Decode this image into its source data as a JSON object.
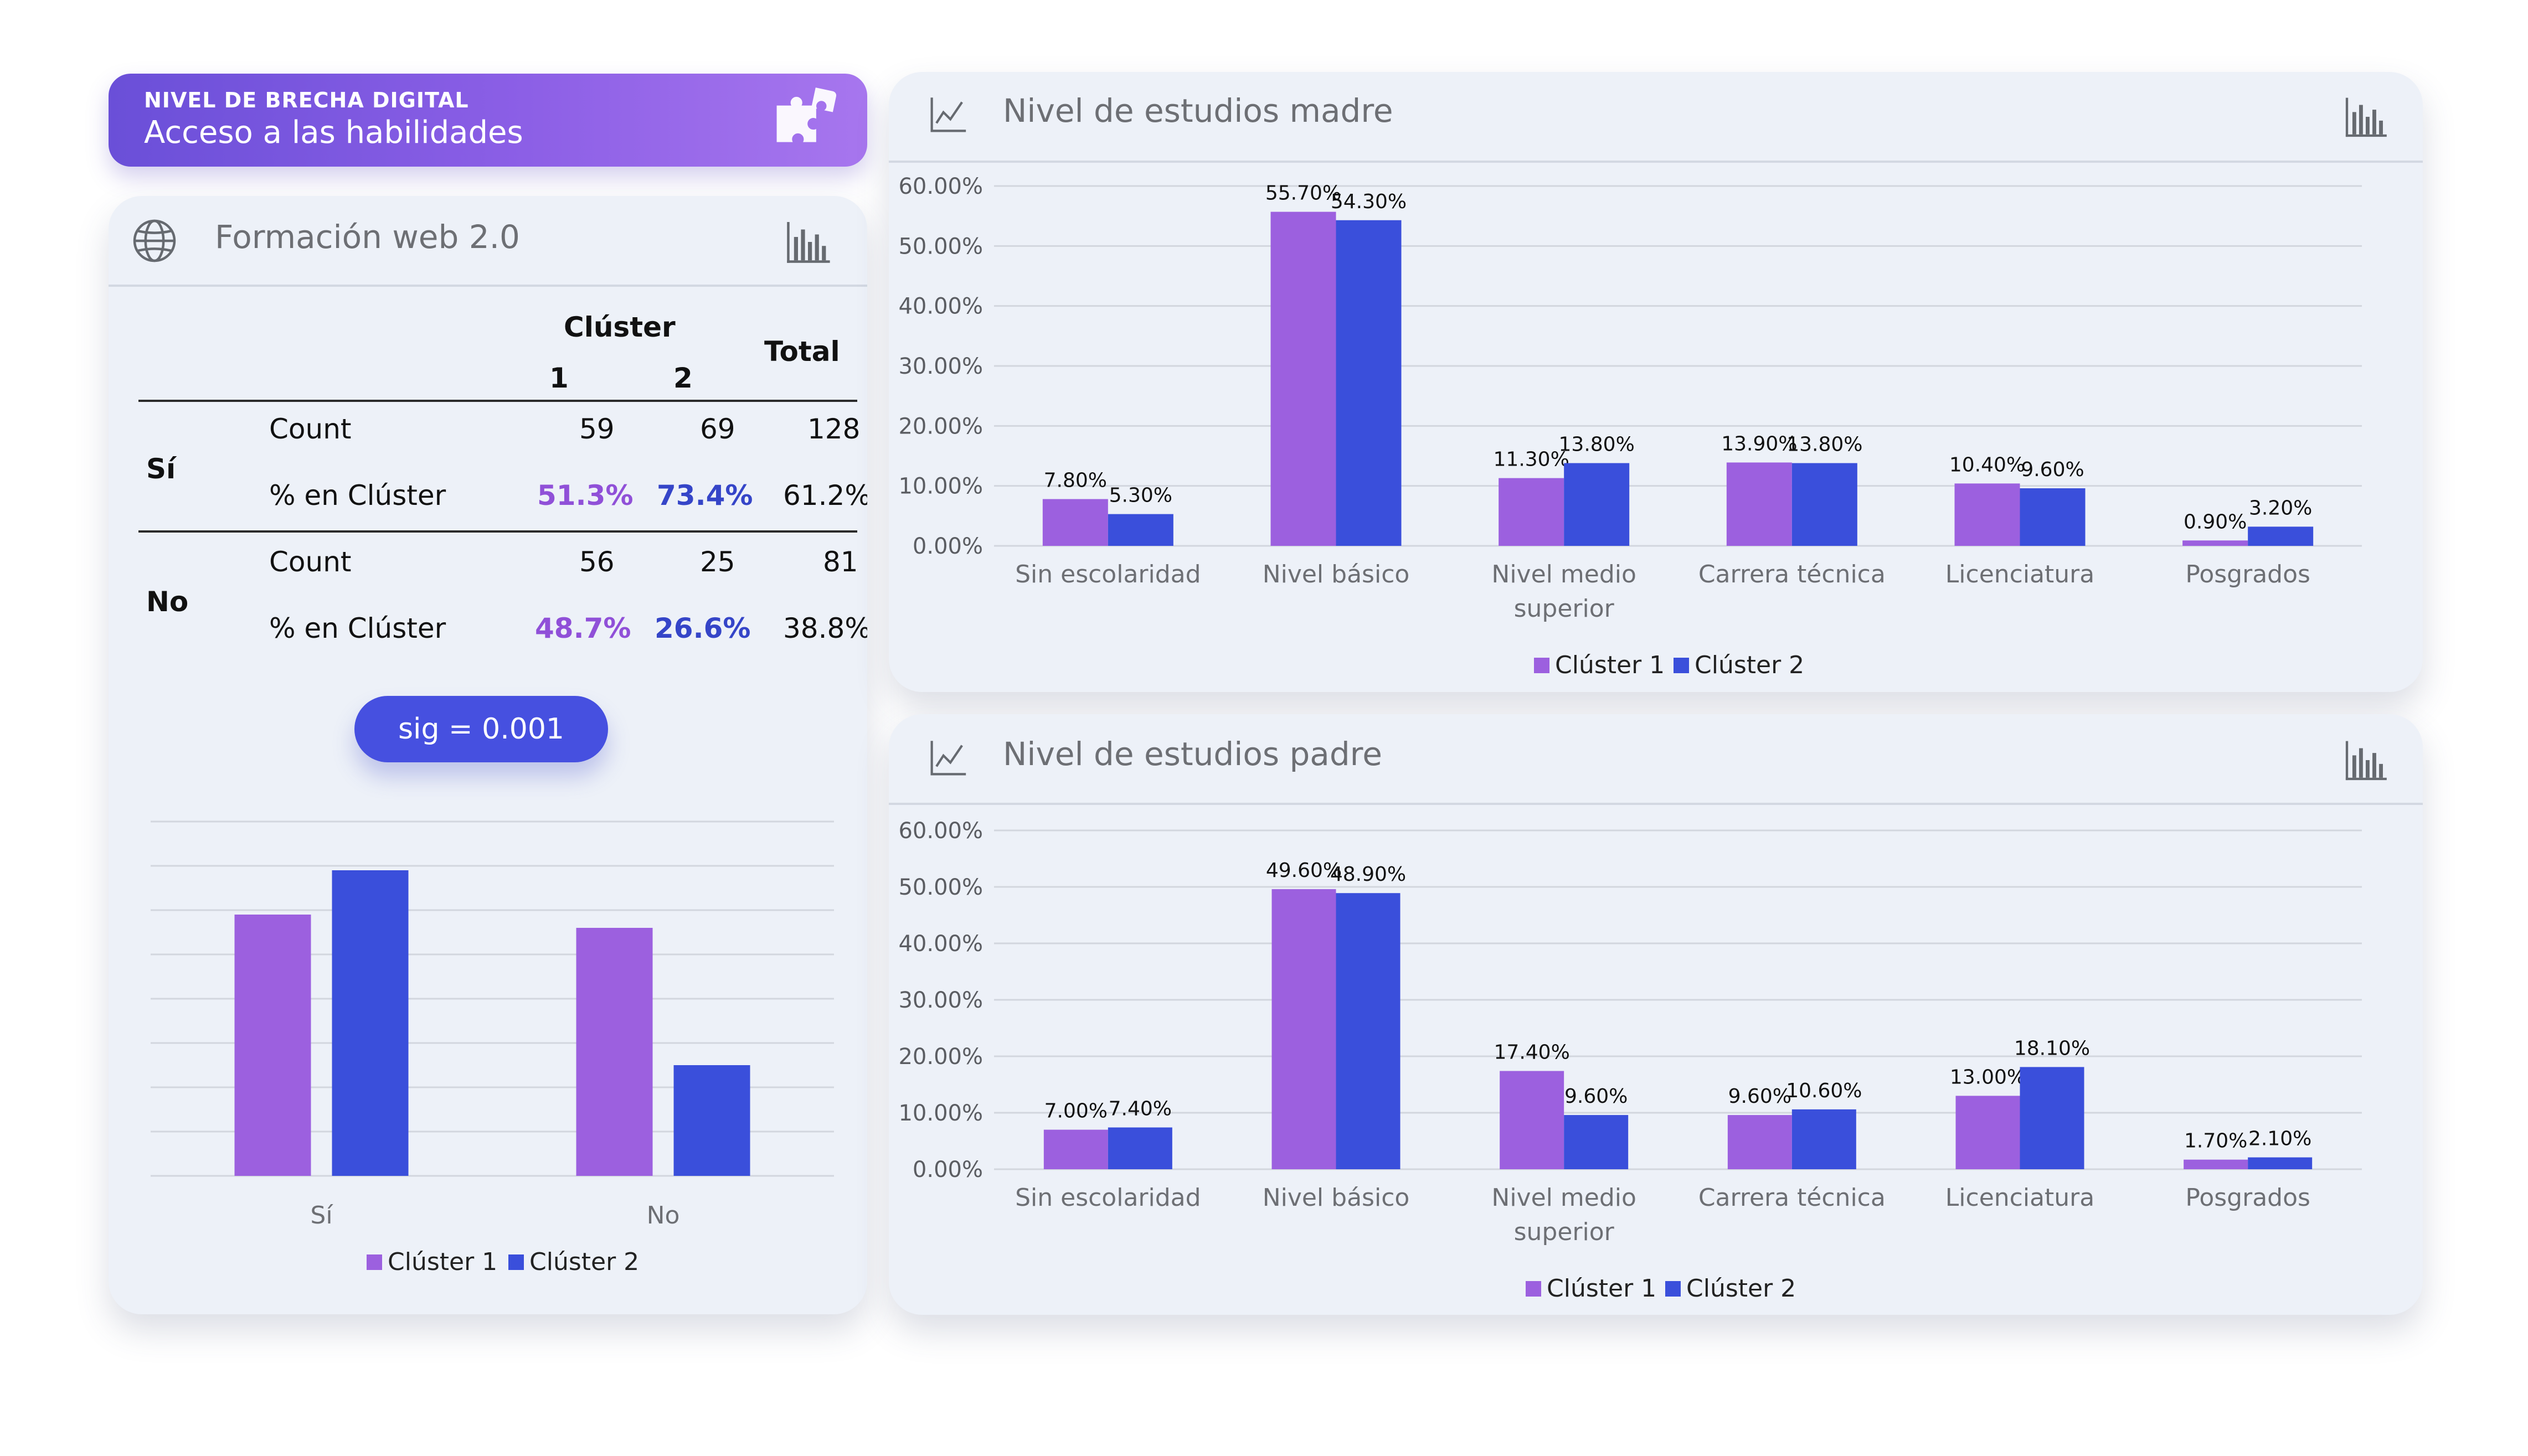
{
  "banner": {
    "kicker": "NIVEL DE BRECHA DIGITAL",
    "title": "Acceso a las habilidades",
    "icon": "puzzle-icon"
  },
  "colors": {
    "cluster1": "#9c60df",
    "cluster2": "#3a4fdb",
    "pct_cluster1": "#9050d8",
    "pct_cluster2": "#3545c8"
  },
  "web": {
    "title": "Formación web 2.0",
    "header_icon": "globe-icon",
    "chart_icon": "bar-chart-icon",
    "table": {
      "cluster_label": "Clúster",
      "col1": "1",
      "col2": "2",
      "total_label": "Total",
      "rows": [
        {
          "group": "Sí",
          "count_label": "Count",
          "count": [
            "59",
            "69",
            "128"
          ],
          "pct_label": "% en Clúster",
          "pct": [
            "51.3%",
            "73.4%",
            "61.2%"
          ]
        },
        {
          "group": "No",
          "count_label": "Count",
          "count": [
            "56",
            "25",
            "81"
          ],
          "pct_label": "% en Clúster",
          "pct": [
            "48.7%",
            "26.6%",
            "38.8%"
          ]
        }
      ]
    },
    "sig_label": "sig = 0.001"
  },
  "madre": {
    "title": "Nivel de estudios madre",
    "header_icon": "trend-chart-icon",
    "chart_icon": "bar-chart-icon"
  },
  "padre": {
    "title": "Nivel de estudios padre",
    "header_icon": "trend-chart-icon",
    "chart_icon": "bar-chart-icon"
  },
  "chart_data": [
    {
      "type": "bar",
      "categories": [
        "Sí",
        "No"
      ],
      "series": [
        {
          "name": "Clúster 1",
          "values": [
            59,
            56
          ]
        },
        {
          "name": "Clúster 2",
          "values": [
            69,
            25
          ]
        }
      ],
      "ylim": [
        0,
        80
      ],
      "grid": true,
      "legend": "bottom"
    },
    {
      "type": "bar",
      "title": "Nivel de estudios madre",
      "categories": [
        "Sin escolaridad",
        "Nivel básico",
        "Nivel medio superior",
        "Carrera técnica",
        "Licenciatura",
        "Posgrados"
      ],
      "series": [
        {
          "name": "Clúster 1",
          "values": [
            7.8,
            55.7,
            11.3,
            13.9,
            10.4,
            0.9
          ],
          "labels": [
            "7.80%",
            "55.70%",
            "11.30%",
            "13.90%",
            "10.40%",
            "0.90%"
          ]
        },
        {
          "name": "Clúster 2",
          "values": [
            5.3,
            54.3,
            13.8,
            13.8,
            9.6,
            3.2
          ],
          "labels": [
            "5.30%",
            "54.30%",
            "13.80%",
            "13.80%",
            "9.60%",
            "3.20%"
          ]
        }
      ],
      "yticks": [
        "0.00%",
        "10.00%",
        "20.00%",
        "30.00%",
        "40.00%",
        "50.00%",
        "60.00%"
      ],
      "ylim": [
        0,
        60
      ],
      "grid": true,
      "legend": "bottom"
    },
    {
      "type": "bar",
      "title": "Nivel de estudios padre",
      "categories": [
        "Sin escolaridad",
        "Nivel básico",
        "Nivel medio superior",
        "Carrera técnica",
        "Licenciatura",
        "Posgrados"
      ],
      "series": [
        {
          "name": "Clúster 1",
          "values": [
            7.0,
            49.6,
            17.4,
            9.6,
            13.0,
            1.7
          ],
          "labels": [
            "7.00%",
            "49.60%",
            "17.40%",
            "9.60%",
            "13.00%",
            "1.70%"
          ]
        },
        {
          "name": "Clúster 2",
          "values": [
            7.4,
            48.9,
            9.6,
            10.6,
            18.1,
            2.1
          ],
          "labels": [
            "7.40%",
            "48.90%",
            "9.60%",
            "10.60%",
            "18.10%",
            "2.10%"
          ]
        }
      ],
      "yticks": [
        "0.00%",
        "10.00%",
        "20.00%",
        "30.00%",
        "40.00%",
        "50.00%",
        "60.00%"
      ],
      "ylim": [
        0,
        60
      ],
      "grid": true,
      "legend": "bottom"
    }
  ]
}
